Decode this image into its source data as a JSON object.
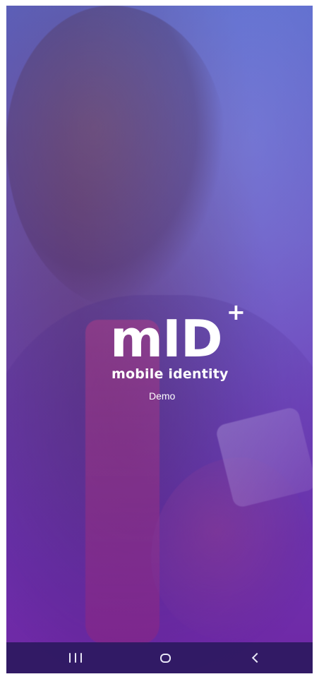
{
  "splash": {
    "logo_text": "mID",
    "logo_superscript": "+",
    "tagline": "mobile identity",
    "subtitle": "Demo",
    "background_image": "business-man-using-tablet-photo"
  },
  "navigation_bar": {
    "recent_apps_icon": "recent-apps-icon",
    "home_icon": "home-icon",
    "back_icon": "back-icon"
  },
  "colors": {
    "overlay_top": "#5b66c8",
    "overlay_bottom": "#6b2aa2",
    "nav_bar": "#2d195f",
    "text": "#ffffff"
  }
}
